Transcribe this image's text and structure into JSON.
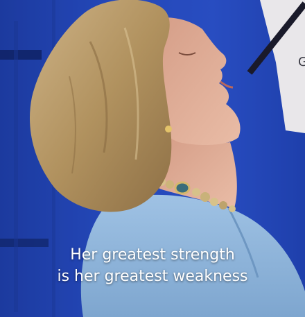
{
  "caption": {
    "line1": "Her greatest strength",
    "line2": "is her greatest weakness"
  },
  "colors": {
    "backdrop": "#2447b8",
    "hair": "#b99a6a",
    "skin": "#e0b19a",
    "jacket": "#8eb6dc",
    "caption_text": "#ffffff"
  }
}
